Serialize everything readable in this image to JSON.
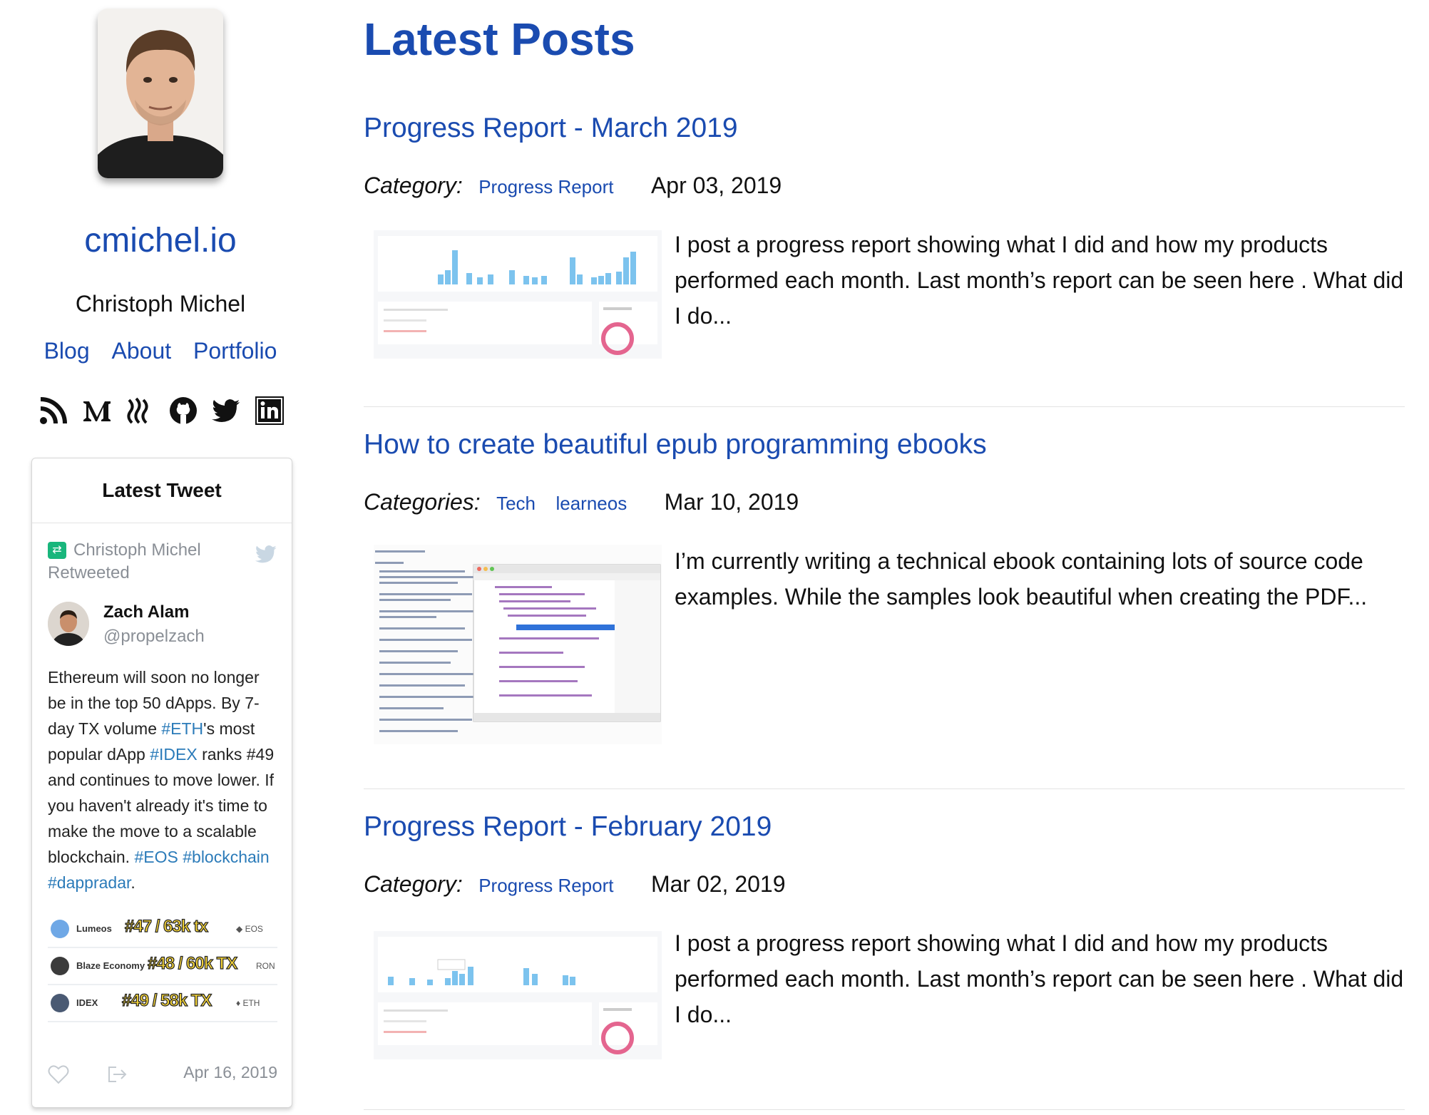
{
  "sidebar": {
    "site_title": "cmichel.io",
    "author": "Christoph Michel",
    "nav": [
      "Blog",
      "About",
      "Portfolio"
    ],
    "social_icons": [
      "rss-icon",
      "medium-icon",
      "steem-icon",
      "github-icon",
      "twitter-icon",
      "linkedin-icon"
    ]
  },
  "tweet": {
    "header": "Latest Tweet",
    "retweeted_by": "Christoph Michel",
    "retweeted_label": "Retweeted",
    "author_name": "Zach Alam",
    "author_handle": "@propelzach",
    "text_parts": [
      {
        "t": "Ethereum will soon no longer be in the top 50 dApps. By 7-day TX volume ",
        "tag": false
      },
      {
        "t": "#ETH",
        "tag": true
      },
      {
        "t": "'s most popular dApp ",
        "tag": false
      },
      {
        "t": "#IDEX",
        "tag": true
      },
      {
        "t": " ranks #49 and continues to move lower. If you haven't already it's time to make the move to a scalable blockchain. ",
        "tag": false
      },
      {
        "t": "#EOS",
        "tag": true
      },
      {
        "t": " ",
        "tag": false
      },
      {
        "t": "#blockchain",
        "tag": true
      },
      {
        "t": " ",
        "tag": false
      },
      {
        "t": "#dappradar",
        "tag": true
      },
      {
        "t": ".",
        "tag": false
      }
    ],
    "embed_rows": [
      {
        "name": "Lumeos",
        "rank": "#47 / 63k tx",
        "chain": "◆ EOS",
        "logo_color": "#6fa8e6"
      },
      {
        "name": "Blaze Economy",
        "rank": "#48 / 60k TX",
        "chain": "RON",
        "logo_color": "#3b3b3b"
      },
      {
        "name": "IDEX",
        "rank": "#49 / 58k TX",
        "chain": "♦ ETH",
        "logo_color": "#4a5a73"
      }
    ],
    "date": "Apr 16, 2019"
  },
  "main": {
    "title": "Latest Posts",
    "posts": [
      {
        "title": "Progress Report - March 2019",
        "category_label": "Category:",
        "categories": [
          "Progress Report"
        ],
        "date": "Apr 03, 2019",
        "excerpt": "I post a progress report showing what I did and how my products performed each month. Last month’s report can be seen here . What did I do...",
        "thumb": "chart"
      },
      {
        "title": "How to create beautiful epub programming ebooks",
        "category_label": "Categories:",
        "categories": [
          "Tech",
          "learneos"
        ],
        "date": "Mar 10, 2019",
        "excerpt": "I’m currently writing a technical ebook containing lots of source code examples. While the samples look beautiful when creating the PDF...",
        "thumb": "code"
      },
      {
        "title": "Progress Report - February 2019",
        "category_label": "Category:",
        "categories": [
          "Progress Report"
        ],
        "date": "Mar 02, 2019",
        "excerpt": "I post a progress report showing what I did and how my products performed each month. Last month’s report can be seen here . What did I do...",
        "thumb": "chart2"
      }
    ]
  },
  "colors": {
    "accent": "#1a4bb0",
    "hashtag": "#2b7bb9",
    "retweet": "#19b67c",
    "muted": "#8a8f96"
  }
}
